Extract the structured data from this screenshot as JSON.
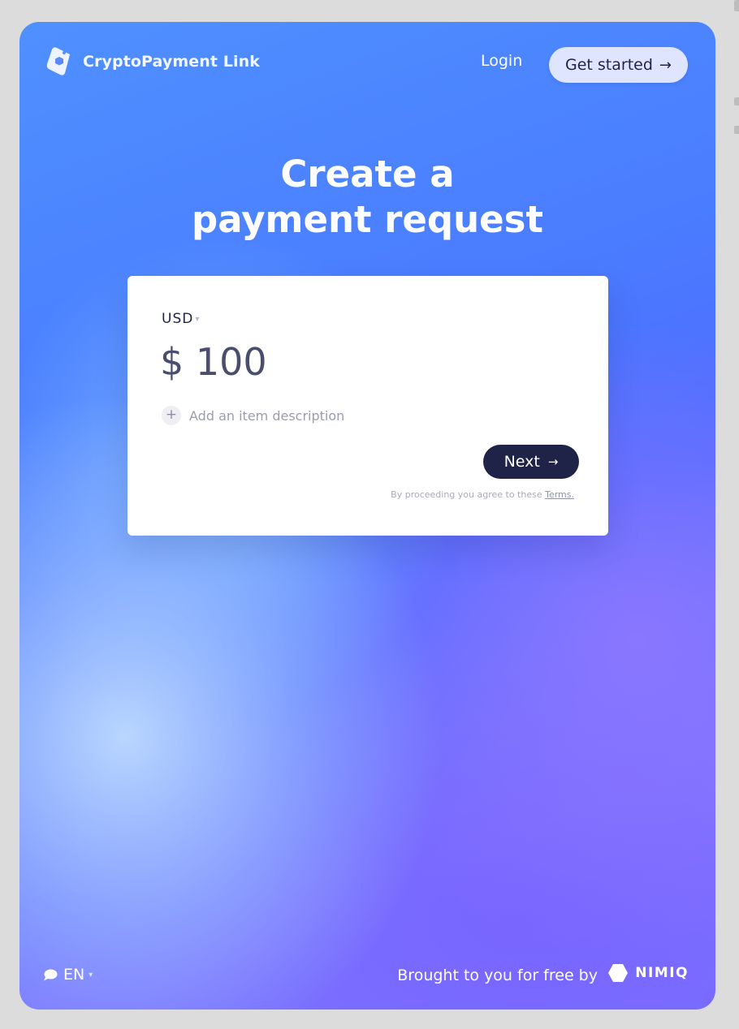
{
  "header": {
    "app_name": "CryptoPayment Link",
    "login_label": "Login",
    "get_started_label": "Get started",
    "get_started_arrow": "→"
  },
  "hero": {
    "title": "Create a payment request"
  },
  "form": {
    "currency": "USD",
    "currency_caret": "▾",
    "amount_value": "$ 100",
    "add_description_plus": "+",
    "add_description_label": "Add an item description",
    "next_label": "Next",
    "next_arrow": "→",
    "terms_prefix": "By proceeding you agree to these",
    "terms_link": "Terms."
  },
  "footer": {
    "language": "EN",
    "language_caret": "▾",
    "brought_by": "Brought to you for free by",
    "brand": "NIMIQ"
  },
  "colors": {
    "primary_dark": "#1f2348",
    "gradient_blue": "#4a7cff",
    "gradient_violet": "#7b70ff",
    "card": "#ffffff"
  },
  "icons": {
    "logo": "tag-hexagon-icon",
    "language": "chat-bubble-icon",
    "brand": "nimiq-hexagon-icon"
  }
}
